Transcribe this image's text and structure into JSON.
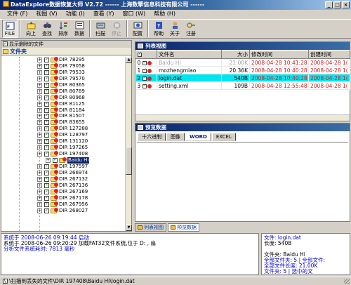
{
  "window": {
    "title": "DataExplore数据恢复大师 V2.72  ------ 上海数擎信息科技有限公司 ------"
  },
  "menu": [
    "文件 (F)",
    "视图 (V)",
    "功能 (I)",
    "查看 (Y)",
    "窗口 (W)",
    "帮助 (H)"
  ],
  "toolbar": [
    {
      "label": "FILE",
      "icon": "file-icon",
      "pressed": true
    },
    {
      "label": "向上",
      "icon": "up-folder-icon"
    },
    {
      "label": "查找",
      "icon": "binoculars-icon"
    },
    {
      "label": "排序",
      "icon": "sort-icon"
    },
    {
      "label": "数据",
      "icon": "data-icon"
    },
    {
      "label": "扫描",
      "icon": "scan-icon"
    },
    {
      "label": "停止",
      "icon": "stop-icon",
      "disabled": true
    },
    {
      "label": "配置",
      "icon": "config-icon"
    },
    {
      "label": "帮助",
      "icon": "help-icon"
    },
    {
      "label": "关于",
      "icon": "about-icon"
    },
    {
      "label": "注册",
      "icon": "register-icon"
    }
  ],
  "left": {
    "show_deleted_label": "显示删除的文件",
    "folder_tab": "文件夹",
    "tree": [
      "DIR 78295",
      "DIR 79058",
      "DIR 79533",
      "DIR 79570",
      "DIR 80365",
      "DIR 80789",
      "DIR 80968",
      "DIR 81125",
      "DIR 81184",
      "DIR 81507",
      "DIR 83655",
      "DIR 127288",
      "DIR 128797",
      "DIR 131120",
      "DIR 197265",
      "DIR 197408",
      "Baidu Hi",
      "DIR 197597",
      "DIR 266974",
      "DIR 267132",
      "DIR 267136",
      "DIR 267169",
      "DIR 267178",
      "DIR 267956",
      "DIR 268027"
    ]
  },
  "listview": {
    "title": "列表视图",
    "columns": [
      "文件名",
      "大小",
      "修改时间",
      "创建时间"
    ],
    "rows": [
      {
        "num": "0",
        "name": "Baidu Hi",
        "size": "21.00K",
        "mtime": "2008-04-28 10:41:28",
        "ctime": "2008-04-28 1("
      },
      {
        "num": "1",
        "name": "mozhengmiao",
        "size": "20.36K",
        "mtime": "2008-04-28 10:40:28",
        "ctime": "2008-04-28 1("
      },
      {
        "num": "2",
        "name": "login.dat",
        "size": "540B",
        "mtime": "2008-04-28 10:40:28",
        "ctime": "2008-04-28 1("
      },
      {
        "num": "3",
        "name": "setting.xml",
        "size": "109B",
        "mtime": "2008-04-28 12:55:48",
        "ctime": "2008-04-28 1("
      }
    ]
  },
  "preview": {
    "title": "预览数据",
    "tabs": [
      "十六进制",
      "图像",
      "WORD",
      "EXCEL"
    ]
  },
  "bottom_tabs": [
    "列表视图",
    "预览数据"
  ],
  "log": [
    {
      "text": "系统于  2008-06-26 09:19:44 启动",
      "blue": true
    },
    {
      "text": "系统于  2008-06-26 09:20:29 加载FAT32文件系统,位于 D: ,  扇",
      "blue": false
    },
    {
      "text": "分析文件系统耗时: 7813 毫秒",
      "blue": true
    }
  ],
  "info": [
    {
      "text": "文件: login.dat",
      "blue": true
    },
    {
      "text": "长度: 540B",
      "blue": false
    },
    {
      "text": "",
      "blue": false
    },
    {
      "text": "文件夹: Baidu Hi",
      "blue": false
    },
    {
      "text": "全部文件夹: 5  | 全部文件:",
      "blue": true
    },
    {
      "text": "全部文件长度: 21.00K",
      "blue": true
    },
    {
      "text": "文件夹: 5   | 选中的文",
      "blue": true
    }
  ],
  "status": "\\扫描到丢失的文件\\DIR 197408\\Baidu Hi\\login.dat"
}
